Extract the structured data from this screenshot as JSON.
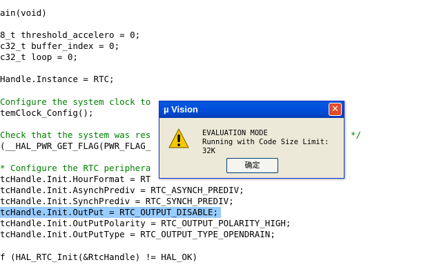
{
  "editor": {
    "lines": [
      {
        "text": "ain(void)",
        "style": "plain"
      },
      {
        "text": "8_t threshold_accelero = 0;",
        "style": "plain"
      },
      {
        "text": "c32_t buffer_index = 0;",
        "style": "plain"
      },
      {
        "text": "c32_t loop = 0;",
        "style": "plain"
      },
      {
        "text": "Handle.Instance = RTC;",
        "style": "plain"
      },
      {
        "text": "Configure the system clock to",
        "style": "comment"
      },
      {
        "text": "temClock_Config();",
        "style": "plain"
      },
      {
        "text": "Check that the system was res",
        "style": "comment"
      },
      {
        "text": "*/",
        "style": "comment"
      },
      {
        "text": "(__HAL_PWR_GET_FLAG(PWR_FLAG_",
        "style": "plain"
      },
      {
        "text": "* Configure the RTC periphera",
        "style": "comment"
      },
      {
        "text": "tcHandle.Init.HourFormat = RT",
        "style": "plain"
      },
      {
        "text": "tcHandle.Init.AsynchPrediv = RTC_ASYNCH_PREDIV;",
        "style": "plain"
      },
      {
        "text": "tcHandle.Init.SynchPrediv = RTC_SYNCH_PREDIV;",
        "style": "plain"
      },
      {
        "text": "tcHandle.Init.OutPut = RTC_OUTPUT_DISABLE;",
        "style": "highlight"
      },
      {
        "text": "tcHandle.Init.OutPutPolarity = RTC_OUTPUT_POLARITY_HIGH;",
        "style": "plain"
      },
      {
        "text": "tcHandle.Init.OutPutType = RTC_OUTPUT_TYPE_OPENDRAIN;",
        "style": "plain"
      },
      {
        "text": "f (HAL_RTC_Init(&RtcHandle) != HAL_OK)",
        "style": "plain"
      }
    ]
  },
  "dialog": {
    "title": "µ Vision",
    "close_glyph": "✕",
    "icon": "warning-icon",
    "message_line1": "EVALUATION MODE",
    "message_line2": "Running with Code Size Limit: 32K",
    "ok_label": "确定"
  },
  "colors": {
    "comment": "#008000",
    "keyword": "#0000ff",
    "highlight": "#99ccff",
    "titlebar": "#0050e0",
    "dialog_bg": "#ece9d8"
  }
}
